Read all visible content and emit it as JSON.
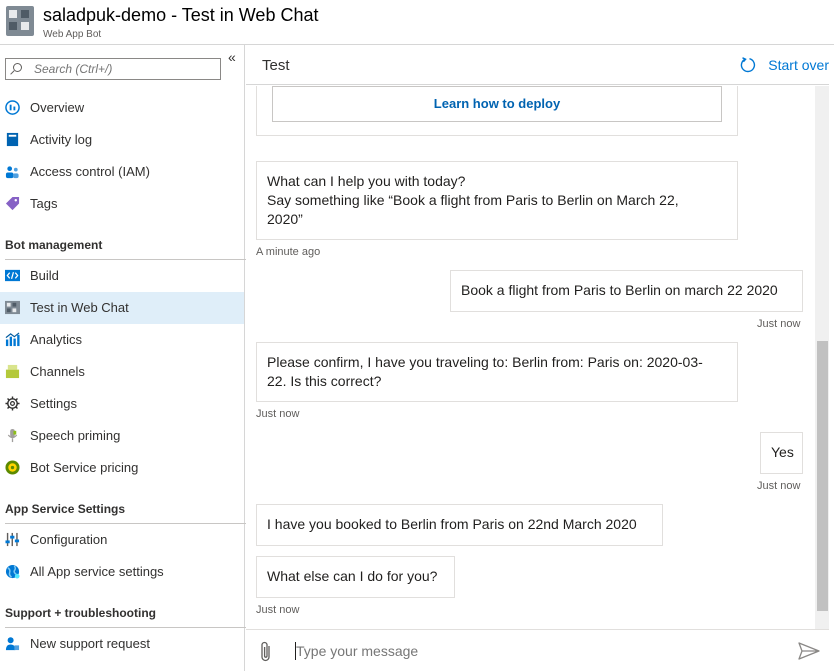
{
  "header": {
    "title": "saladpuk-demo - Test in Web Chat",
    "subtitle": "Web App Bot"
  },
  "sidebar": {
    "search_placeholder": "Search (Ctrl+/)",
    "collapse_glyph": "«",
    "items": [
      {
        "label": "Overview",
        "icon": "overview-icon"
      },
      {
        "label": "Activity log",
        "icon": "activity-log-icon"
      },
      {
        "label": "Access control (IAM)",
        "icon": "iam-icon"
      },
      {
        "label": "Tags",
        "icon": "tag-icon"
      }
    ],
    "sections": [
      {
        "title": "Bot management",
        "items": [
          {
            "label": "Build",
            "icon": "code-icon"
          },
          {
            "label": "Test in Web Chat",
            "icon": "web-chat-icon",
            "selected": true
          },
          {
            "label": "Analytics",
            "icon": "analytics-icon"
          },
          {
            "label": "Channels",
            "icon": "channels-icon"
          },
          {
            "label": "Settings",
            "icon": "gear-icon"
          },
          {
            "label": "Speech priming",
            "icon": "microphone-icon"
          },
          {
            "label": "Bot Service pricing",
            "icon": "pricing-icon"
          }
        ]
      },
      {
        "title": "App Service Settings",
        "items": [
          {
            "label": "Configuration",
            "icon": "sliders-icon"
          },
          {
            "label": "All App service settings",
            "icon": "globe-icon"
          }
        ]
      },
      {
        "title": "Support + troubleshooting",
        "items": [
          {
            "label": "New support request",
            "icon": "person-icon"
          }
        ]
      }
    ]
  },
  "test_pane": {
    "title": "Test",
    "start_over_label": "Start over",
    "card_button_label": "Learn how to deploy",
    "messages": [
      {
        "from": "bot",
        "lines": [
          "What can I help you with today?",
          "Say something like “Book a flight from Paris to Berlin on March 22,",
          "2020”"
        ],
        "timestamp": "A minute ago"
      },
      {
        "from": "user",
        "lines": [
          "Book a flight from Paris to Berlin on march 22 2020"
        ],
        "timestamp": "Just now"
      },
      {
        "from": "bot",
        "lines": [
          "Please confirm, I have you traveling to: Berlin from: Paris on: 2020-03-",
          "22. Is this correct?"
        ],
        "timestamp": "Just now"
      },
      {
        "from": "user",
        "lines": [
          "Yes"
        ],
        "timestamp": "Just now"
      },
      {
        "from": "bot",
        "lines": [
          "I have you booked to Berlin from Paris on 22nd March 2020"
        ],
        "timestamp": ""
      },
      {
        "from": "bot",
        "lines": [
          "What else can I do for you?"
        ],
        "timestamp": "Just now"
      }
    ],
    "input_placeholder": "Type your message"
  },
  "colors": {
    "accent": "#0078d4",
    "selected_bg": "#dfeef9",
    "border": "#e1dfdd"
  }
}
